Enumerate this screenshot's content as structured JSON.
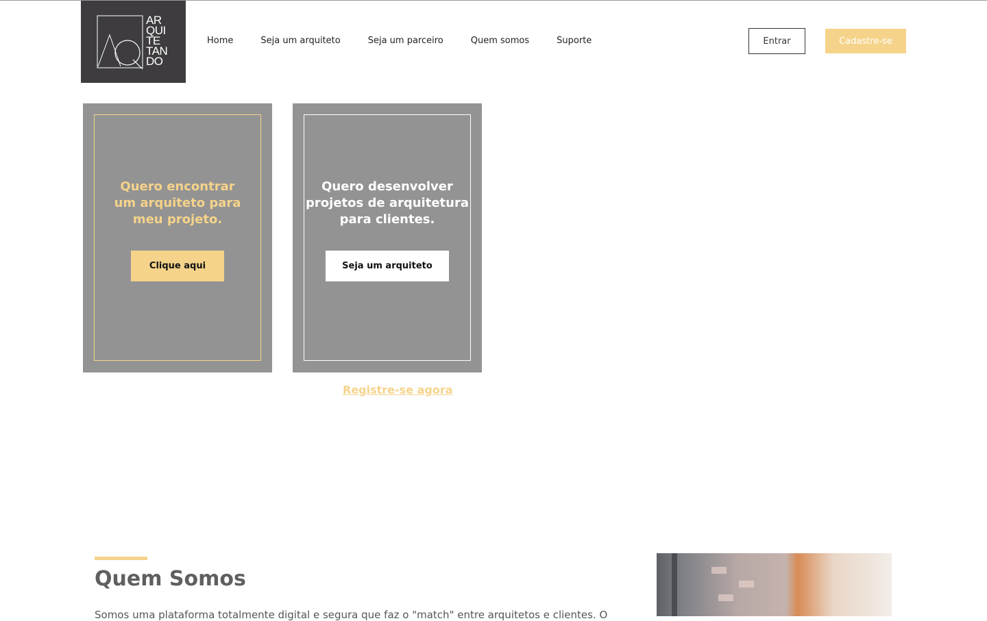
{
  "logo": {
    "lines": [
      "AR",
      "QUI",
      "TE",
      "TAN",
      "DO"
    ]
  },
  "nav": {
    "items": [
      "Home",
      "Seja um arquiteto",
      "Seja um parceiro",
      "Quem somos",
      "Suporte"
    ]
  },
  "header": {
    "login_label": "Entrar",
    "signup_label": "Cadastre-se"
  },
  "cards": [
    {
      "heading": "Quero encontrar um arquiteto para meu projeto.",
      "cta": "Clique aqui"
    },
    {
      "heading": "Quero desenvolver projetos de arquitetura para clientes.",
      "cta": "Seja um arquiteto"
    }
  ],
  "register_link": "Registre-se agora",
  "about": {
    "title": "Quem Somos",
    "text": "Somos uma plataforma totalmente digital e segura que faz o \"match\" entre arquitetos e clientes. O"
  },
  "colors": {
    "accent": "#f5d38a",
    "card_bg": "#939393",
    "logo_bg": "#3e3c3f"
  }
}
